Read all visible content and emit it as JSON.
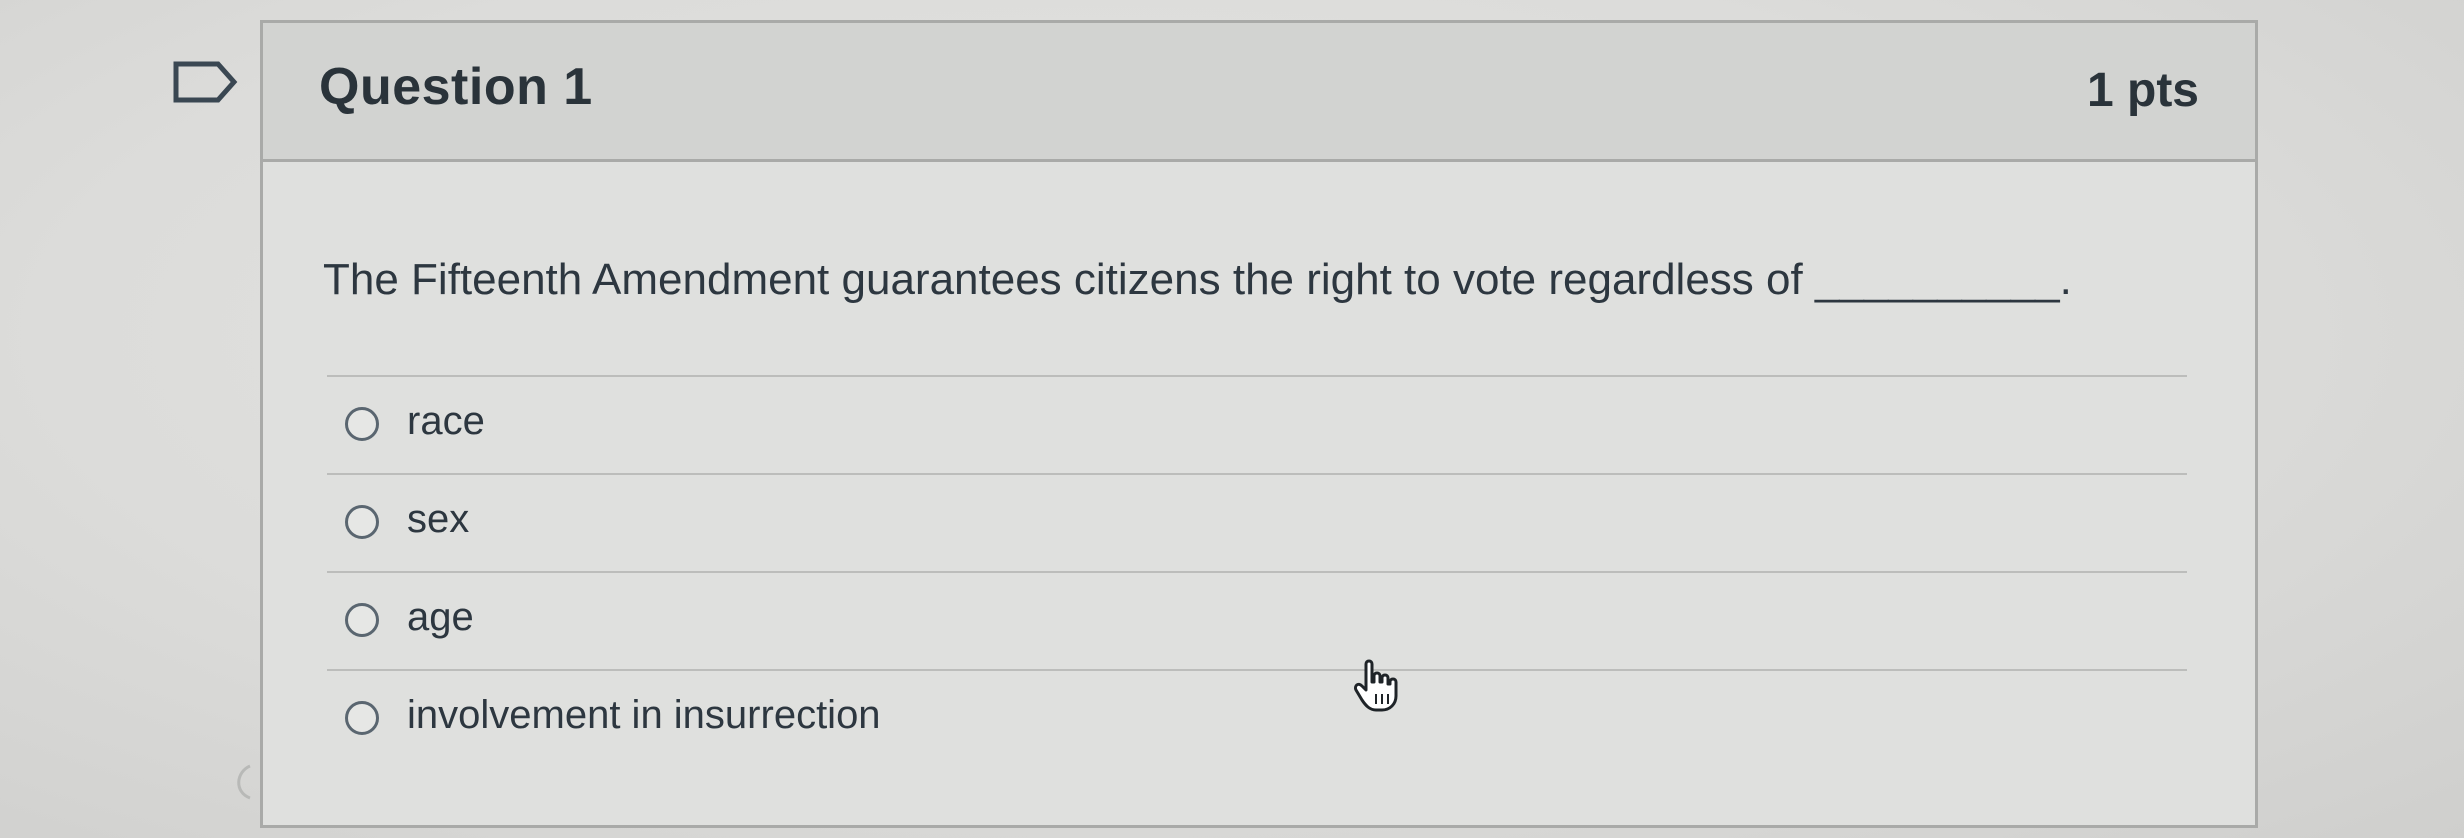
{
  "question": {
    "title": "Question 1",
    "points": "1 pts",
    "text": "The Fifteenth Amendment guarantees citizens the right to vote regardless of __________."
  },
  "answers": [
    {
      "label": "race",
      "selected": false
    },
    {
      "label": "sex",
      "selected": false
    },
    {
      "label": "age",
      "selected": false
    },
    {
      "label": "involvement in insurrection",
      "selected": false
    }
  ],
  "icons": {
    "flag": "flag-icon",
    "cursor": "hand-pointer-icon",
    "radio": "radio-unchecked-icon"
  },
  "colors": {
    "background": "#d9d9d7",
    "header": "#d2d3d1",
    "border": "#a9aaa8",
    "text": "#2d3740"
  }
}
